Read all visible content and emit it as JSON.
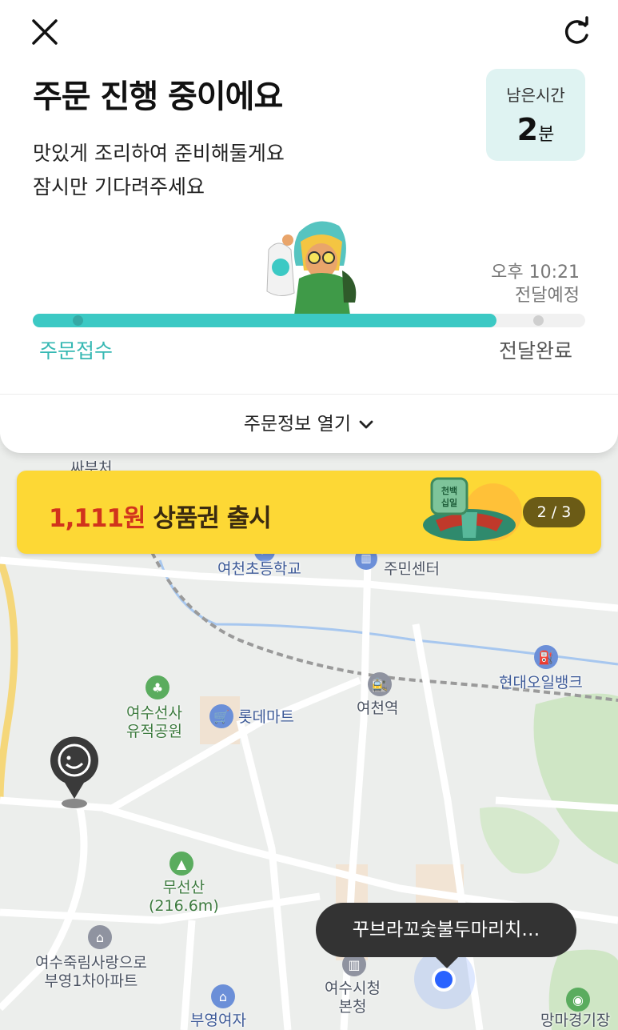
{
  "header": {
    "title": "주문 진행 중이에요",
    "subtitle_line1": "맛있게 조리하여 준비해둘게요",
    "subtitle_line2": "잠시만 기다려주세요",
    "remaining_label": "남은시간",
    "remaining_value": "2",
    "remaining_unit": "분"
  },
  "progress": {
    "fraction": 0.84,
    "start_label": "주문접수",
    "end_label": "전달완료",
    "eta_time": "오후 10:21",
    "eta_label": "전달예정",
    "accent_color": "#3cc9c4"
  },
  "order_info_toggle": "주문정보 열기",
  "banner": {
    "amount": "1,111원",
    "text": "상품권 출시",
    "page_indicator": "2 / 3",
    "badge_text": "천백십일"
  },
  "map": {
    "labels": {
      "school": "여천초등학교",
      "center": "주민센터",
      "gas": "현대오일뱅크",
      "station": "여천역",
      "mart": "롯데마트",
      "park_line1": "여수선사",
      "park_line2": "유적공원",
      "mountain_line1": "무선산",
      "mountain_line2": "(216.6m)",
      "apt_line1": "여수죽림사랑으로",
      "apt_line2": "부영1차아파트",
      "cityhall_line1": "여수시청",
      "cityhall_line2": "본청",
      "school2": "부영여자",
      "stadium": "망마경기장",
      "top_partial": "싸부처"
    },
    "tooltip": "꾸브라꼬숯불두마리치…"
  }
}
